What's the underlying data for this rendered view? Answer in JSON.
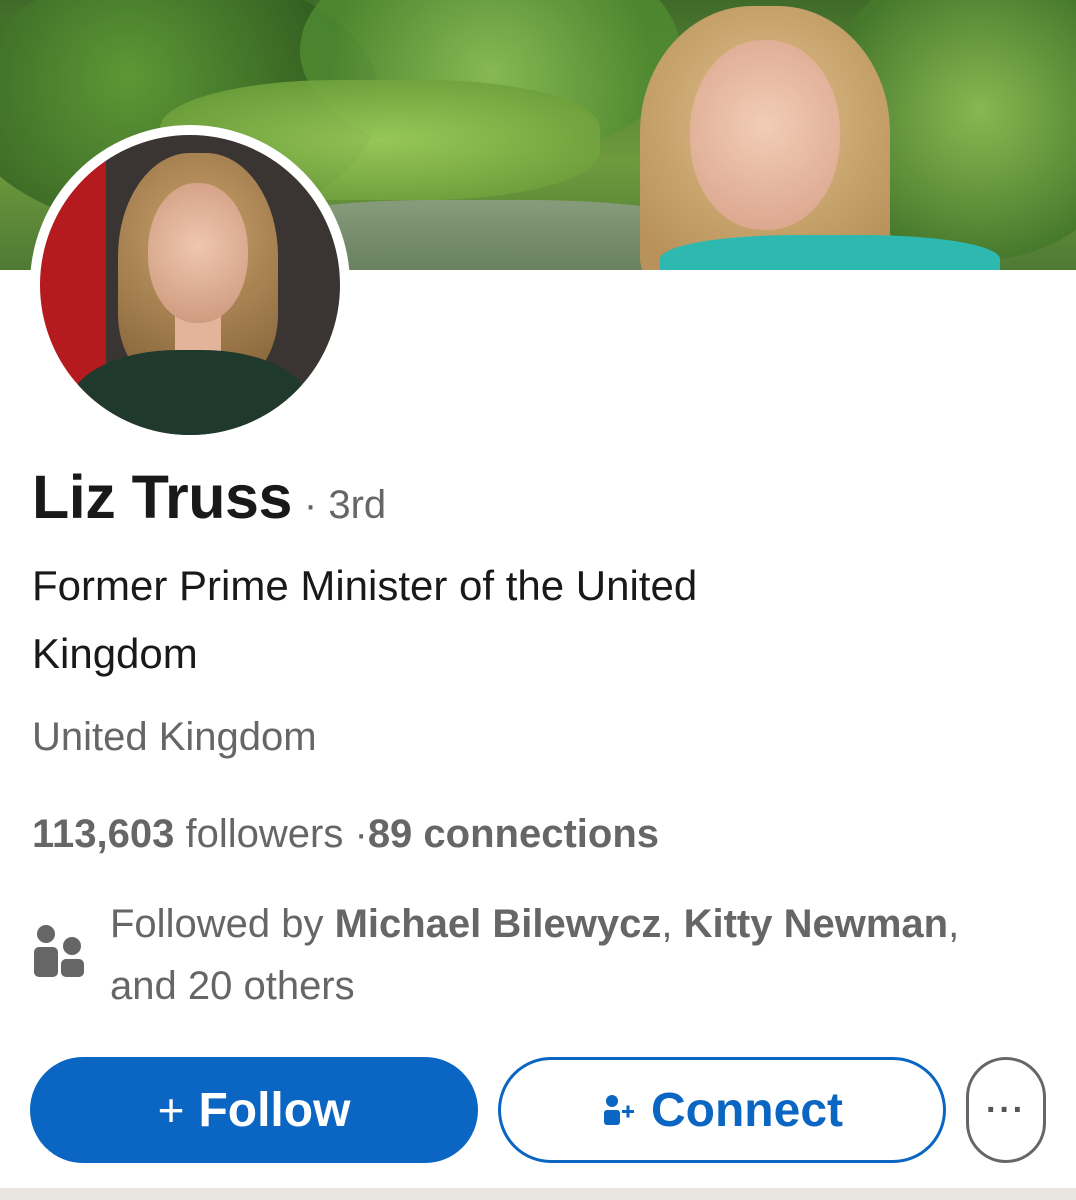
{
  "profile": {
    "name": "Liz Truss",
    "degree": "· 3rd",
    "headline": "Former Prime Minister of the United Kingdom",
    "location": "United Kingdom",
    "followers_count": "113,603",
    "followers_label": "followers",
    "separator": "·",
    "connections": "89 connections",
    "mutual": {
      "prefix": "Followed by ",
      "name1": "Michael Bilewycz",
      "sep": ", ",
      "name2": "Kitty Newman",
      "suffix": ", and 20 others",
      "icon": "people-icon"
    }
  },
  "actions": {
    "follow_symbol": "+",
    "follow_label": "Follow",
    "connect_label": "Connect",
    "connect_icon": "add-person-icon",
    "more_label": "···"
  },
  "colors": {
    "primary": "#0a66c2",
    "text": "#191919",
    "muted": "#666666"
  }
}
